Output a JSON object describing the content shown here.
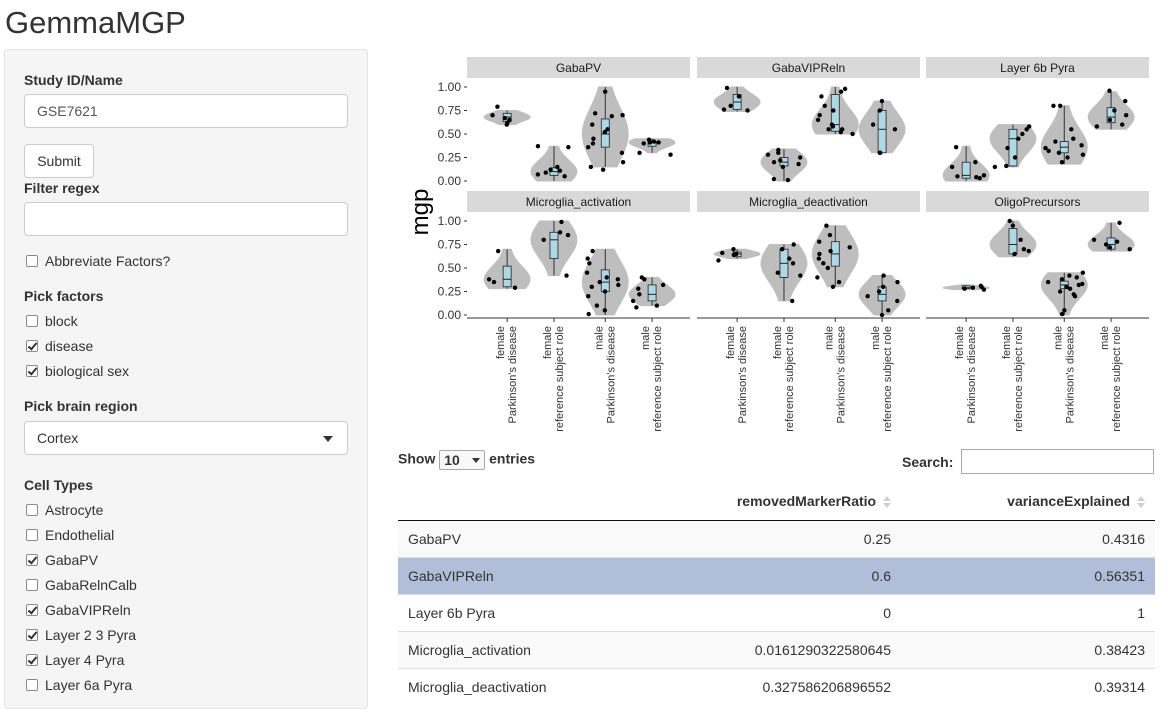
{
  "app": {
    "title": "GemmaMGP"
  },
  "sidebar": {
    "study_label": "Study ID/Name",
    "study_value": "GSE7621",
    "submit_label": "Submit",
    "filter_label": "Filter regex",
    "filter_value": "",
    "abbreviate": {
      "label": "Abbreviate Factors?",
      "checked": false
    },
    "factors_label": "Pick factors",
    "factors": [
      {
        "label": "block",
        "checked": false
      },
      {
        "label": "disease",
        "checked": true
      },
      {
        "label": "biological sex",
        "checked": true
      }
    ],
    "region_label": "Pick brain region",
    "region_value": "Cortex",
    "celltypes_label": "Cell Types",
    "cell_types": [
      {
        "label": "Astrocyte",
        "checked": false
      },
      {
        "label": "Endothelial",
        "checked": false
      },
      {
        "label": "GabaPV",
        "checked": true
      },
      {
        "label": "GabaRelnCalb",
        "checked": false
      },
      {
        "label": "GabaVIPReln",
        "checked": true
      },
      {
        "label": "Layer 2 3 Pyra",
        "checked": true
      },
      {
        "label": "Layer 4 Pyra",
        "checked": true
      },
      {
        "label": "Layer 6a Pyra",
        "checked": false
      }
    ]
  },
  "chart_data": {
    "type": "violin",
    "ylabel": "mgp",
    "ylim": [
      0,
      1
    ],
    "yticks": [
      "0.00",
      "0.25",
      "0.50",
      "0.75",
      "1.00"
    ],
    "groups": [
      [
        "female",
        "Parkinson's disease"
      ],
      [
        "female",
        "reference subject role"
      ],
      [
        "male",
        "Parkinson's disease"
      ],
      [
        "male",
        "reference subject role"
      ]
    ],
    "panels": [
      {
        "name": "GabaPV",
        "groups": [
          {
            "q1": 0.63,
            "med": 0.68,
            "q3": 0.72,
            "lo": 0.6,
            "hi": 0.75,
            "pts": [
              0.6,
              0.65,
              0.7,
              0.79,
              0.67,
              0.62
            ]
          },
          {
            "q1": 0.06,
            "med": 0.1,
            "q3": 0.14,
            "lo": 0.0,
            "hi": 0.37,
            "pts": [
              0.37,
              0.36,
              0.15,
              0.12,
              0.09,
              0.05,
              0.11,
              0.07
            ]
          },
          {
            "q1": 0.36,
            "med": 0.5,
            "q3": 0.66,
            "lo": 0.15,
            "hi": 1.0,
            "pts": [
              0.95,
              0.72,
              0.69,
              0.6,
              0.55,
              0.52,
              0.4,
              0.36,
              0.3,
              0.2,
              0.15,
              0.12,
              0.7,
              0.45
            ]
          },
          {
            "q1": 0.37,
            "med": 0.41,
            "q3": 0.42,
            "lo": 0.3,
            "hi": 0.45,
            "pts": [
              0.44,
              0.42,
              0.41,
              0.4,
              0.3,
              0.28,
              0.41
            ]
          }
        ]
      },
      {
        "name": "GabaVIPReln",
        "groups": [
          {
            "q1": 0.76,
            "med": 0.84,
            "q3": 0.92,
            "lo": 0.74,
            "hi": 1.0,
            "pts": [
              0.99,
              0.9,
              0.8,
              0.76,
              0.75
            ]
          },
          {
            "q1": 0.16,
            "med": 0.2,
            "q3": 0.25,
            "lo": 0.0,
            "hi": 0.34,
            "pts": [
              0.33,
              0.3,
              0.28,
              0.25,
              0.2,
              0.18,
              0.15,
              0.02,
              0.01,
              0.22
            ]
          },
          {
            "q1": 0.53,
            "med": 0.6,
            "q3": 0.92,
            "lo": 0.5,
            "hi": 1.0,
            "pts": [
              0.98,
              0.95,
              0.9,
              0.8,
              0.75,
              0.7,
              0.65,
              0.6,
              0.55,
              0.52,
              0.5,
              0.55,
              0.58
            ]
          },
          {
            "q1": 0.3,
            "med": 0.55,
            "q3": 0.75,
            "lo": 0.3,
            "hi": 0.85,
            "pts": [
              0.85,
              0.75,
              0.55,
              0.3,
              0.3,
              0.6
            ]
          }
        ]
      },
      {
        "name": "Layer 6b Pyra",
        "groups": [
          {
            "q1": 0.03,
            "med": 0.06,
            "q3": 0.2,
            "lo": 0.0,
            "hi": 0.37,
            "pts": [
              0.36,
              0.2,
              0.15,
              0.05,
              0.04,
              0.03,
              0.06
            ]
          },
          {
            "q1": 0.16,
            "med": 0.45,
            "q3": 0.55,
            "lo": 0.15,
            "hi": 0.6,
            "pts": [
              0.58,
              0.55,
              0.5,
              0.45,
              0.25,
              0.15,
              0.16,
              0.35
            ]
          },
          {
            "q1": 0.3,
            "med": 0.36,
            "q3": 0.42,
            "lo": 0.18,
            "hi": 0.8,
            "pts": [
              0.8,
              0.8,
              0.55,
              0.45,
              0.42,
              0.38,
              0.35,
              0.3,
              0.25,
              0.2,
              0.32,
              0.28
            ]
          },
          {
            "q1": 0.62,
            "med": 0.68,
            "q3": 0.78,
            "lo": 0.55,
            "hi": 0.95,
            "pts": [
              0.96,
              0.85,
              0.75,
              0.65,
              0.58,
              0.6,
              0.7
            ]
          }
        ]
      },
      {
        "name": "Microglia_activation",
        "groups": [
          {
            "q1": 0.3,
            "med": 0.38,
            "q3": 0.52,
            "lo": 0.28,
            "hi": 0.7,
            "pts": [
              0.68,
              0.38,
              0.35,
              0.29
            ]
          },
          {
            "q1": 0.6,
            "med": 0.8,
            "q3": 0.88,
            "lo": 0.42,
            "hi": 1.0,
            "pts": [
              0.99,
              0.88,
              0.85,
              0.8,
              0.42
            ]
          },
          {
            "q1": 0.25,
            "med": 0.35,
            "q3": 0.48,
            "lo": 0.0,
            "hi": 0.7,
            "pts": [
              0.68,
              0.6,
              0.55,
              0.45,
              0.4,
              0.38,
              0.32,
              0.3,
              0.25,
              0.2,
              0.1,
              0.05,
              0.01,
              0.35
            ]
          },
          {
            "q1": 0.15,
            "med": 0.22,
            "q3": 0.32,
            "lo": 0.1,
            "hi": 0.4,
            "pts": [
              0.4,
              0.38,
              0.32,
              0.28,
              0.22,
              0.15,
              0.1,
              0.08
            ]
          }
        ]
      },
      {
        "name": "Microglia_deactivation",
        "groups": [
          {
            "q1": 0.62,
            "med": 0.65,
            "q3": 0.67,
            "lo": 0.6,
            "hi": 0.7,
            "pts": [
              0.7,
              0.66,
              0.65,
              0.64,
              0.58
            ]
          },
          {
            "q1": 0.4,
            "med": 0.55,
            "q3": 0.7,
            "lo": 0.15,
            "hi": 0.75,
            "pts": [
              0.75,
              0.7,
              0.55,
              0.45,
              0.42,
              0.15,
              0.6
            ]
          },
          {
            "q1": 0.52,
            "med": 0.65,
            "q3": 0.78,
            "lo": 0.3,
            "hi": 0.95,
            "pts": [
              0.95,
              0.85,
              0.78,
              0.72,
              0.65,
              0.6,
              0.55,
              0.5,
              0.4,
              0.35,
              0.3,
              0.68
            ]
          },
          {
            "q1": 0.15,
            "med": 0.22,
            "q3": 0.3,
            "lo": 0.0,
            "hi": 0.42,
            "pts": [
              0.42,
              0.35,
              0.3,
              0.25,
              0.2,
              0.15,
              0.05,
              0.0
            ]
          }
        ]
      },
      {
        "name": "OligoPrecursors",
        "groups": [
          {
            "q1": 0.28,
            "med": 0.29,
            "q3": 0.31,
            "lo": 0.27,
            "hi": 0.32,
            "pts": [
              0.3,
              0.29,
              0.28,
              0.27,
              0.31
            ]
          },
          {
            "q1": 0.65,
            "med": 0.75,
            "q3": 0.92,
            "lo": 0.62,
            "hi": 1.0,
            "pts": [
              1.0,
              0.95,
              0.8,
              0.7,
              0.68,
              0.65
            ]
          },
          {
            "q1": 0.28,
            "med": 0.32,
            "q3": 0.36,
            "lo": 0.0,
            "hi": 0.45,
            "pts": [
              0.45,
              0.42,
              0.4,
              0.38,
              0.35,
              0.33,
              0.3,
              0.28,
              0.25,
              0.22,
              0.2,
              0.05,
              0.01,
              0.32
            ]
          },
          {
            "q1": 0.7,
            "med": 0.75,
            "q3": 0.82,
            "lo": 0.68,
            "hi": 0.98,
            "pts": [
              0.98,
              0.8,
              0.75,
              0.72,
              0.7,
              0.78
            ]
          }
        ]
      }
    ]
  },
  "table": {
    "show_label": "Show",
    "length_value": "10",
    "entries_label": "entries",
    "search_label": "Search:",
    "columns": [
      "",
      "removedMarkerRatio",
      "varianceExplained"
    ],
    "rows": [
      [
        "GabaPV",
        "0.25",
        "0.4316"
      ],
      [
        "GabaVIPReln",
        "0.6",
        "0.56351"
      ],
      [
        "Layer 6b Pyra",
        "0",
        "1"
      ],
      [
        "Microglia_activation",
        "0.0161290322580645",
        "0.38423"
      ],
      [
        "Microglia_deactivation",
        "0.327586206896552",
        "0.39314"
      ]
    ],
    "selected_row": 1
  }
}
